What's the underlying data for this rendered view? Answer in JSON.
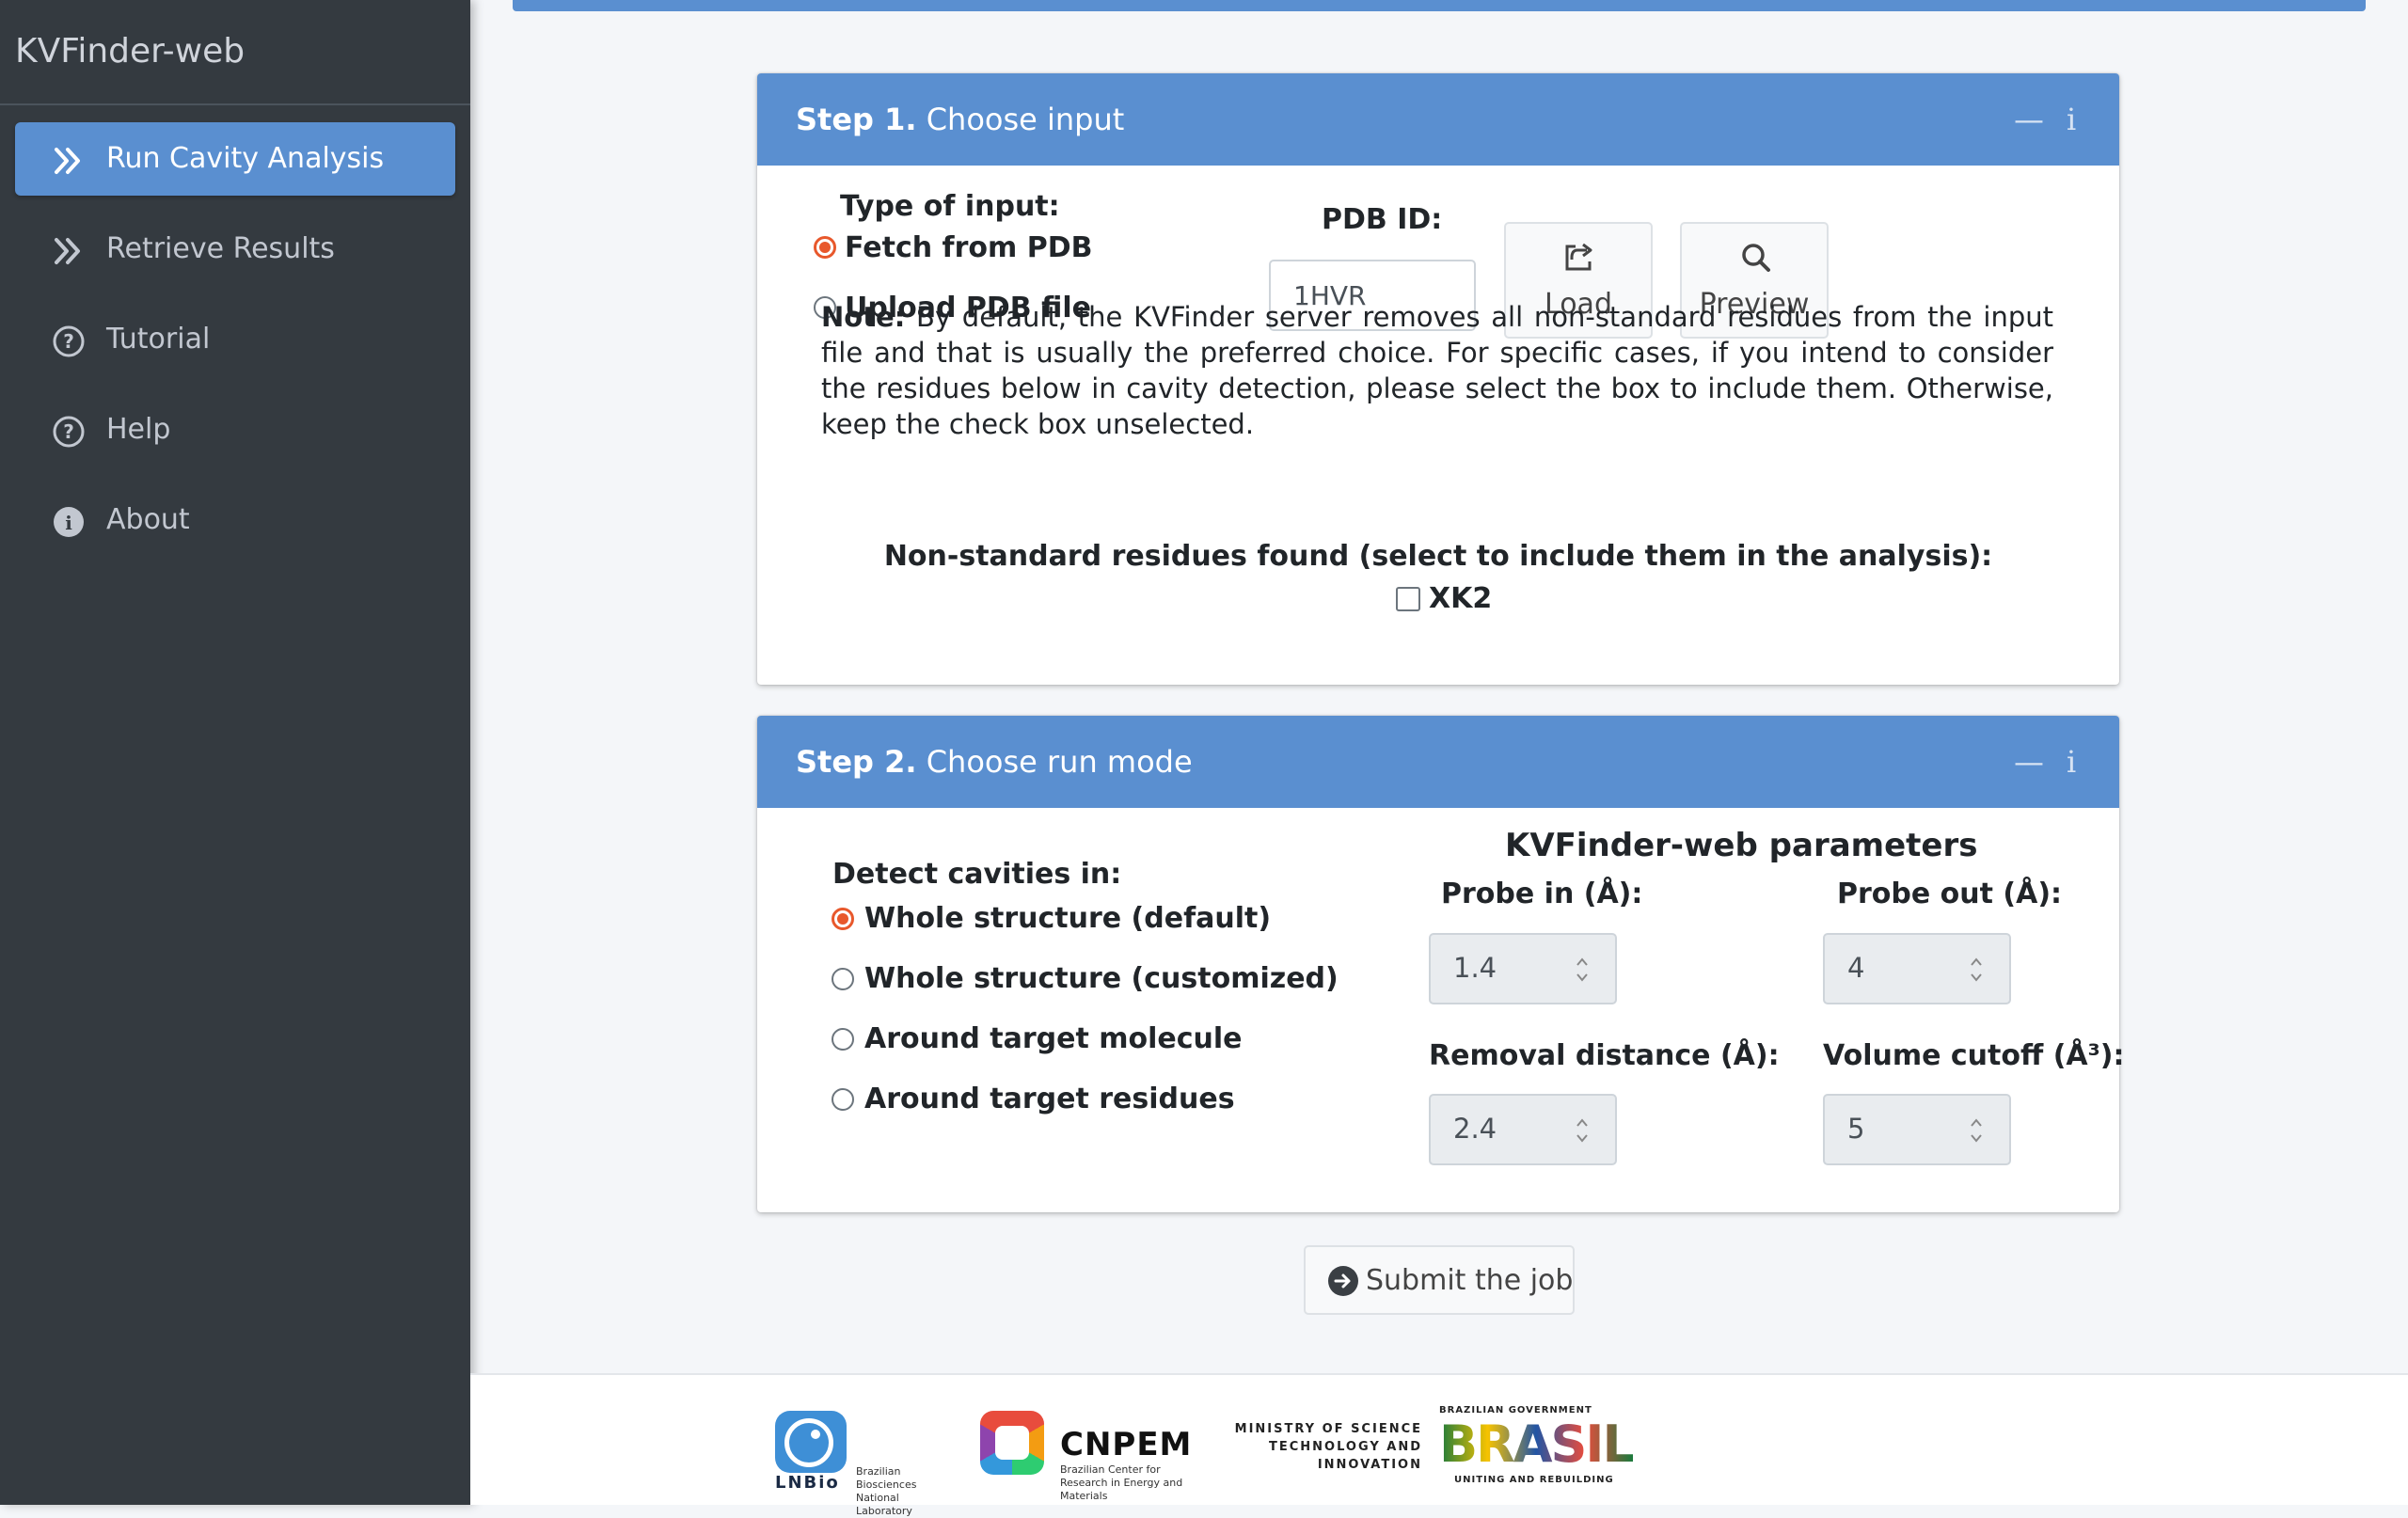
{
  "sidebar": {
    "brand": "KVFinder-web",
    "items": [
      {
        "label": "Run Cavity Analysis",
        "icon": "double-chevron-right-icon",
        "active": true
      },
      {
        "label": "Retrieve Results",
        "icon": "double-chevron-right-icon",
        "active": false
      },
      {
        "label": "Tutorial",
        "icon": "question-circle-icon",
        "active": false
      },
      {
        "label": "Help",
        "icon": "question-circle-icon",
        "active": false
      },
      {
        "label": "About",
        "icon": "info-circle-icon",
        "active": false
      }
    ]
  },
  "step1": {
    "title_bold": "Step 1.",
    "title": "Choose input",
    "type_label": "Type of input:",
    "options": [
      "Fetch from PDB",
      "Upload PDB file"
    ],
    "selected": "Fetch from PDB",
    "pdb_label": "PDB ID:",
    "pdb_value": "1HVR",
    "load_label": "Load",
    "preview_label": "Preview",
    "note_bold": "Note:",
    "note_text": "By default, the KVFinder server removes all non-standard residues from the input file and that is usually the preferred choice. For specific cases, if you intend to consider the residues below in cavity detection, please select the box to include them. Otherwise, keep the check box unselected.",
    "nonstd_label": "Non-standard residues found (select to include them in the analysis):",
    "residue": "XK2",
    "residue_checked": false
  },
  "step2": {
    "title_bold": "Step 2.",
    "title": "Choose run mode",
    "detect_label": "Detect cavities in:",
    "modes": [
      "Whole structure (default)",
      "Whole structure (customized)",
      "Around target molecule",
      "Around target residues"
    ],
    "selected_mode": "Whole structure (default)",
    "params_title": "KVFinder-web parameters",
    "probe_in_label": "Probe in (Å):",
    "probe_in": "1.4",
    "probe_out_label": "Probe out (Å):",
    "probe_out": "4",
    "removal_label": "Removal distance (Å):",
    "removal": "2.4",
    "volume_label": "Volume cutoff (Å³):",
    "volume": "5"
  },
  "submit_label": "Submit the job",
  "footer": {
    "lnbio": "LNBio",
    "lnbio_sub": "Brazilian Biosciences National Laboratory",
    "cnpem": "CNPEM",
    "cnpem_sub": "Brazilian Center for Research in Energy and Materials",
    "ministry": "MINISTRY OF SCIENCE TECHNOLOGY AND INNOVATION",
    "gov_top": "BRAZILIAN GOVERNMENT",
    "gov_word": "BRASIL",
    "gov_bottom": "UNITING AND REBUILDING"
  },
  "colors": {
    "accent": "#5a8fd0",
    "sidebar": "#343a40",
    "radio": "#e8582c"
  }
}
